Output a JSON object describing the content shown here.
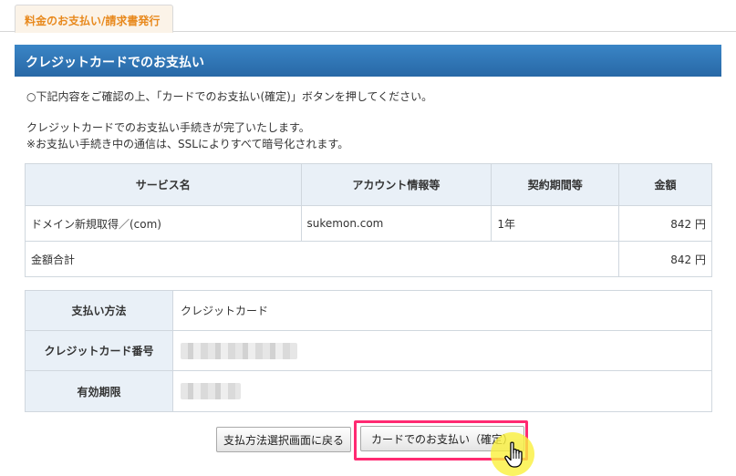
{
  "tab": {
    "label": "料金のお支払い/請求書発行"
  },
  "section": {
    "title": "クレジットカードでのお支払い"
  },
  "instructions": {
    "line1": "○下記内容をご確認の上、「カードでのお支払い(確定)」ボタンを押してください。",
    "line2": "クレジットカードでのお支払い手続きが完了いたします。",
    "line3": "※お支払い手続き中の通信は、SSLによりすべて暗号化されます。"
  },
  "summary": {
    "headers": [
      "サービス名",
      "アカウント情報等",
      "契約期間等",
      "金額"
    ],
    "row": {
      "service": "ドメイン新規取得／(com)",
      "account": "sukemon.com",
      "term": "1年",
      "amount": "842 円"
    },
    "total": {
      "label": "金額合計",
      "amount": "842 円"
    }
  },
  "payment": {
    "method_label": "支払い方法",
    "method_value": "クレジットカード",
    "card_number_label": "クレジットカード番号",
    "expiry_label": "有効期限"
  },
  "buttons": {
    "back": "支払方法選択画面に戻る",
    "confirm": "カードでのお支払い（確定）"
  },
  "colors": {
    "header_blue": "#2e76b8",
    "tab_orange": "#e8891d",
    "highlight_pink": "#ff2a72",
    "cell_header_bg": "#e9f0f7"
  }
}
